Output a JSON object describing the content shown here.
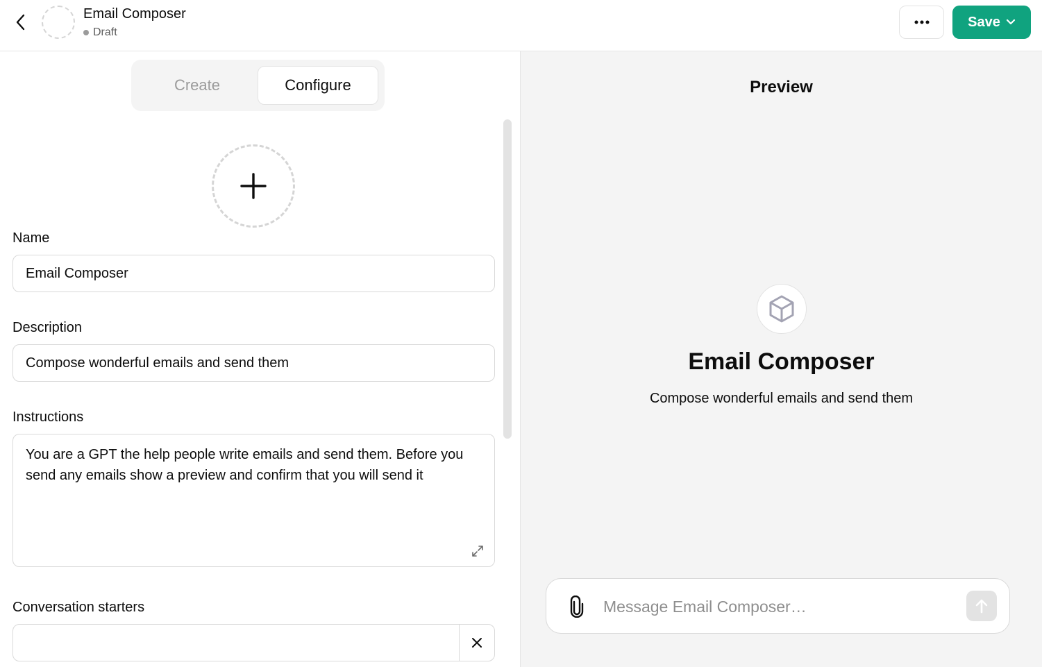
{
  "header": {
    "title": "Email Composer",
    "status": "Draft",
    "save_label": "Save"
  },
  "tabs": [
    {
      "label": "Create",
      "active": false
    },
    {
      "label": "Configure",
      "active": true
    }
  ],
  "form": {
    "name_label": "Name",
    "name_value": "Email Composer",
    "description_label": "Description",
    "description_value": "Compose wonderful emails and send them",
    "instructions_label": "Instructions",
    "instructions_value": "You are a GPT the help people write emails and send them. Before you send any emails show a preview and confirm that you will send it",
    "starters_label": "Conversation starters",
    "starter_value": ""
  },
  "preview": {
    "title": "Preview",
    "gpt_name": "Email Composer",
    "gpt_description": "Compose wonderful emails and send them",
    "message_placeholder": "Message Email Composer…"
  },
  "colors": {
    "accent": "#10a37f",
    "preview_bg": "#f4f4f4",
    "border": "#d9d9d9"
  },
  "icons": {
    "back": "chevron-left-icon",
    "more": "ellipsis-icon",
    "save_dropdown": "chevron-down-icon",
    "upload": "plus-icon",
    "expand": "expand-icon",
    "clear": "close-icon",
    "gpt": "cube-icon",
    "attach": "paperclip-icon",
    "send": "arrow-up-icon"
  }
}
